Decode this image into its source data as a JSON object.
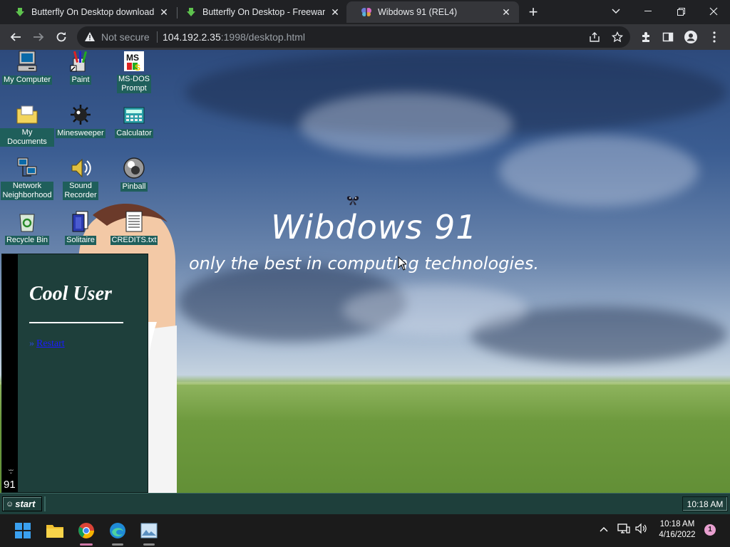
{
  "browser": {
    "tabs": [
      {
        "title": "Butterfly On Desktop download f",
        "state": "inactive"
      },
      {
        "title": "Butterfly On Desktop - Freeware",
        "state": "inactive"
      },
      {
        "title": "Wibdows 91 (REL4)",
        "state": "active"
      }
    ],
    "address": {
      "security_label": "Not secure",
      "host": "104.192.2.35",
      "path": ":1998/desktop.html"
    }
  },
  "desktop": {
    "icons": [
      {
        "label": "My Computer"
      },
      {
        "label": "Paint"
      },
      {
        "label": "MS-DOS\nPrompt"
      },
      {
        "label": "My Documents"
      },
      {
        "label": "Minesweeper"
      },
      {
        "label": "Calculator"
      },
      {
        "label": "Network\nNeighborhood"
      },
      {
        "label": "Sound\nRecorder"
      },
      {
        "label": "Pinball"
      },
      {
        "label": "Recycle Bin"
      },
      {
        "label": "Solitaire"
      },
      {
        "label": "CREDITS.txt"
      }
    ],
    "title": "Wibdows 91",
    "subtitle": "only the best in computing technologies."
  },
  "start_menu": {
    "user": "Cool User",
    "restart_bullet": "»",
    "restart_label": "Restart",
    "stripe_label": "91",
    "stripe_glyph": "ᵕ̮ᵕ"
  },
  "w91_taskbar": {
    "start_label": "start",
    "clock": "10:18 AM"
  },
  "windows_taskbar": {
    "time": "10:18 AM",
    "date": "4/16/2022",
    "notification_count": "1"
  },
  "colors": {
    "teal": "#1e3f3b",
    "icon_label_bg": "#1f5f5b",
    "chrome_dark": "#202124",
    "chrome_toolbar": "#35363a"
  }
}
